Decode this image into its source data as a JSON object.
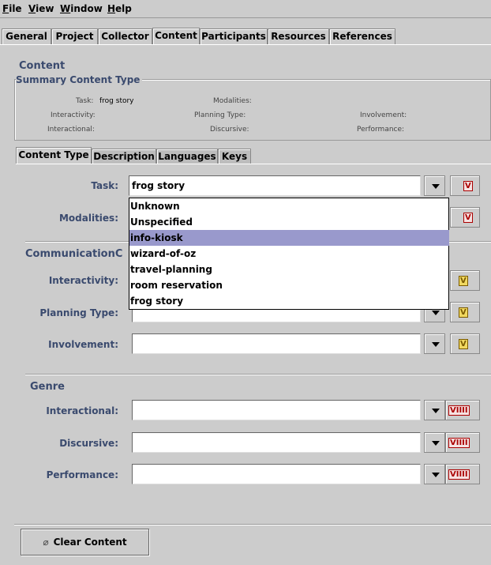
{
  "menubar": {
    "items": [
      {
        "label": "File",
        "mnemonic": "F"
      },
      {
        "label": "View",
        "mnemonic": "V"
      },
      {
        "label": "Window",
        "mnemonic": "W"
      },
      {
        "label": "Help",
        "mnemonic": "H"
      }
    ]
  },
  "top_tabs": [
    "General",
    "Project",
    "Collector",
    "Content",
    "Participants",
    "Resources",
    "References"
  ],
  "active_top_tab": "Content",
  "content": {
    "title": "Content",
    "summary": {
      "legend": "Summary Content Type",
      "task_label": "Task:",
      "task_value": "frog story",
      "modalities_label": "Modalities:",
      "interactivity_label": "Interactivity:",
      "planning_type_label": "Planning Type:",
      "involvement_label": "Involvement:",
      "interactional_label": "Interactional:",
      "discursive_label": "Discursive:",
      "performance_label": "Performance:"
    }
  },
  "sub_tabs": [
    "Content Type",
    "Description",
    "Languages",
    "Keys"
  ],
  "active_sub_tab": "Content Type",
  "form": {
    "task_label": "Task:",
    "task_value": "frog story",
    "modalities_label": "Modalities:",
    "communication_title": "CommunicationC",
    "interactivity_label": "Interactivity:",
    "planning_type_label": "Planning Type:",
    "involvement_label": "Involvement:",
    "genre_title": "Genre",
    "interactional_label": "Interactional:",
    "discursive_label": "Discursive:",
    "performance_label": "Performance:"
  },
  "task_dropdown": {
    "options": [
      "Unknown",
      "Unspecified",
      "info-kiosk",
      "wizard-of-oz",
      "travel-planning",
      "room reservation",
      "frog story"
    ],
    "highlighted": "info-kiosk"
  },
  "vocab_button_labels": {
    "closed": "V",
    "open": "V",
    "multi": "VIIII"
  },
  "clear_button": {
    "label": "Clear Content",
    "icon": "eraser-icon"
  },
  "colors": {
    "background": "#cccccc",
    "label_blue": "#3a4a6e",
    "selection": "#9999cc"
  }
}
